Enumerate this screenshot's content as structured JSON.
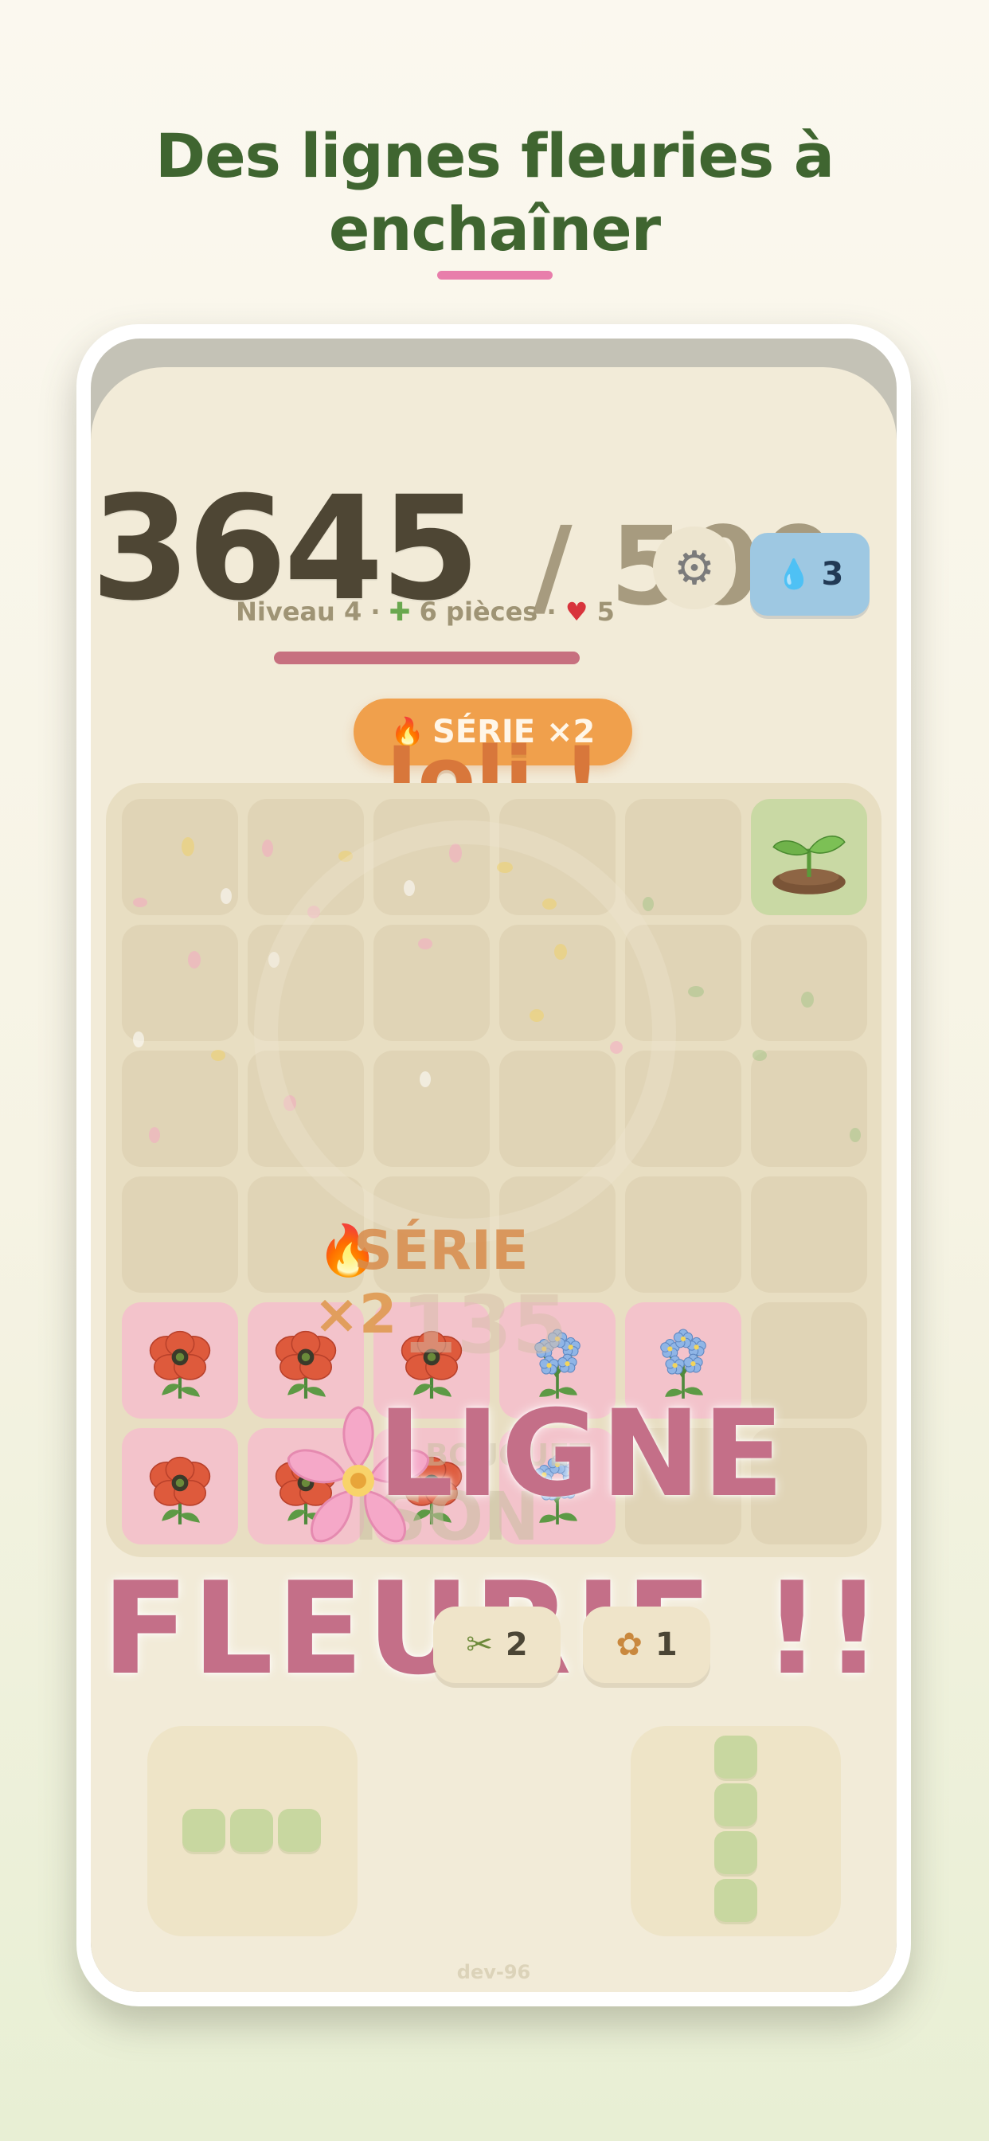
{
  "headline": {
    "line1": "Des lignes fleuries à",
    "line2": "enchaîner"
  },
  "hud": {
    "score": "3645",
    "target": "/ 500",
    "water_count": "3",
    "water_icon": "water-drop-icon",
    "settings_icon": "gear-icon",
    "level_label": "Niveau 4",
    "pieces_label": "6 pièces",
    "lives": "5",
    "progress_fraction": 0.6,
    "progress_color": "#c7707f"
  },
  "streak": {
    "label": "SÉRIE ×2",
    "flame_icon": "flame-icon"
  },
  "praise": "Joli !",
  "combo": {
    "serie_label": "SÉRIE",
    "multiplier": "×2",
    "ghost_number": "135",
    "ghost_lines": [
      "BOUQUET",
      "ISON"
    ]
  },
  "banner": {
    "line1": "LIGNE",
    "line2": "FLEURIE !!",
    "color": "#c46f88"
  },
  "board": {
    "rows": [
      [
        "empty",
        "empty",
        "empty",
        "empty",
        "empty",
        "sprout"
      ],
      [
        "empty",
        "empty",
        "empty",
        "empty",
        "empty",
        "empty"
      ],
      [
        "empty",
        "empty",
        "empty",
        "empty",
        "empty",
        "empty"
      ],
      [
        "empty",
        "empty",
        "empty",
        "empty",
        "empty",
        "empty"
      ],
      [
        "poppy",
        "poppy",
        "poppy",
        "forget-me-not",
        "forget-me-not",
        "empty"
      ],
      [
        "poppy",
        "poppy",
        "poppy",
        "forget-me-not",
        "empty",
        "empty"
      ]
    ]
  },
  "powerups": [
    {
      "icon": "shears-icon",
      "count": "2"
    },
    {
      "icon": "bouquet-icon",
      "count": "1"
    }
  ],
  "pieces_tray": [
    {
      "shape": "horizontal-3"
    },
    {
      "shape": "vertical-4"
    }
  ],
  "build_label": "dev-96",
  "colors": {
    "headline": "#3f6530",
    "accent_pink": "#e87eab",
    "streak_orange": "#f0a04c",
    "water_blue": "#9ec8e2"
  }
}
